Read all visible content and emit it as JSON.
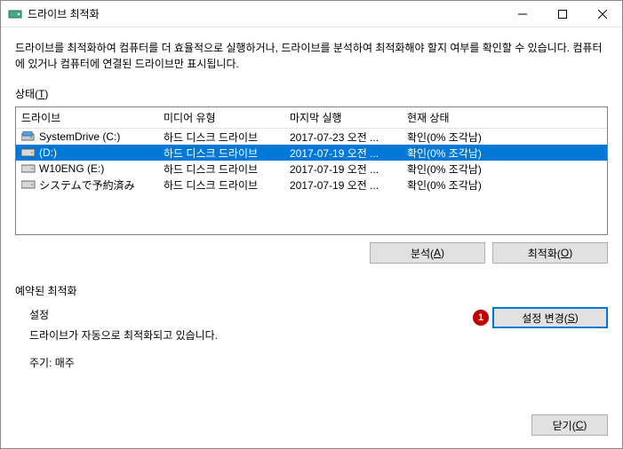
{
  "title": "드라이브 최적화",
  "description": "드라이브를 최적화하여 컴퓨터를 더 효율적으로 실행하거나, 드라이브를 분석하여 최적화해야 할지 여부를 확인할 수 있습니다. 컴퓨터에 있거나 컴퓨터에 연결된 드라이브만 표시됩니다.",
  "status_label_prefix": "상태(",
  "status_label_key": "T",
  "status_label_suffix": ")",
  "columns": {
    "drive": "드라이브",
    "media": "미디어 유형",
    "last": "마지막 실행",
    "status": "현재 상태"
  },
  "rows": [
    {
      "name": "SystemDrive (C:)",
      "icon": "system",
      "media": "하드 디스크 드라이브",
      "last": "2017-07-23 오전 ...",
      "status": "확인(0% 조각남)",
      "selected": false
    },
    {
      "name": "(D:)",
      "icon": "hdd",
      "media": "하드 디스크 드라이브",
      "last": "2017-07-19 오전 ...",
      "status": "확인(0% 조각남)",
      "selected": true
    },
    {
      "name": "W10ENG (E:)",
      "icon": "hdd",
      "media": "하드 디스크 드라이브",
      "last": "2017-07-19 오전 ...",
      "status": "확인(0% 조각남)",
      "selected": false
    },
    {
      "name": "システムで予約済み",
      "icon": "hdd",
      "media": "하드 디스크 드라이브",
      "last": "2017-07-19 오전 ...",
      "status": "확인(0% 조각남)",
      "selected": false
    }
  ],
  "buttons": {
    "analyze_prefix": "분석(",
    "analyze_key": "A",
    "analyze_suffix": ")",
    "optimize_prefix": "최적화(",
    "optimize_key": "O",
    "optimize_suffix": ")",
    "change_prefix": "설정 변경(",
    "change_key": "S",
    "change_suffix": ")",
    "close_prefix": "닫기(",
    "close_key": "C",
    "close_suffix": ")"
  },
  "schedule": {
    "section_label": "예약된 최적화",
    "settings_title": "설정",
    "auto_line": "드라이브가 자동으로 최적화되고 있습니다.",
    "freq_line": "주기: 매주"
  },
  "badge": "1"
}
